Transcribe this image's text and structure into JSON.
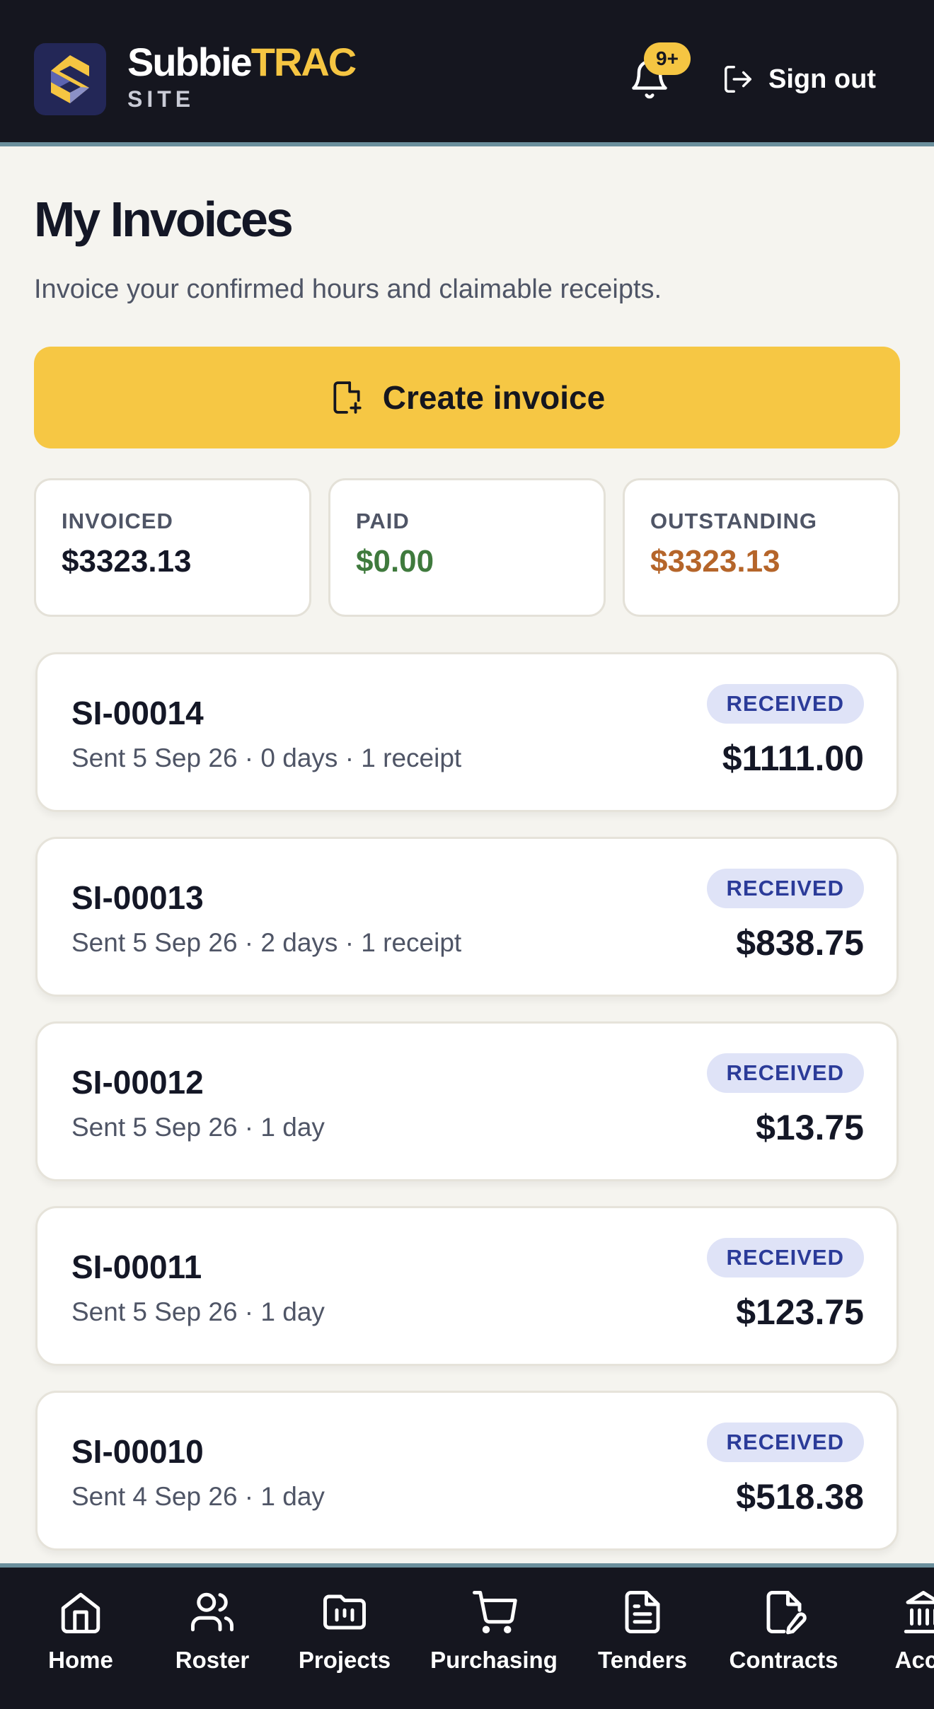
{
  "brand": {
    "name_a": "Subbie",
    "name_b": "TRAC",
    "sub": "SITE"
  },
  "header": {
    "badge": "9+",
    "signout_label": "Sign out"
  },
  "page": {
    "title": "My Invoices",
    "subtitle": "Invoice your confirmed hours and claimable receipts.",
    "create_label": "Create invoice"
  },
  "stats": [
    {
      "label": "INVOICED",
      "value": "$3323.13",
      "color": "#141726"
    },
    {
      "label": "PAID",
      "value": "$0.00",
      "color": "#3f7a3d"
    },
    {
      "label": "OUTSTANDING",
      "value": "$3323.13",
      "color": "#b5652a"
    }
  ],
  "invoices": [
    {
      "id": "SI-00014",
      "meta": "Sent 5 Sep 26 · 0 days · 1 receipt",
      "status": "RECEIVED",
      "amount": "$1111.00"
    },
    {
      "id": "SI-00013",
      "meta": "Sent 5 Sep 26 · 2 days · 1 receipt",
      "status": "RECEIVED",
      "amount": "$838.75"
    },
    {
      "id": "SI-00012",
      "meta": "Sent 5 Sep 26 · 1 day",
      "status": "RECEIVED",
      "amount": "$13.75"
    },
    {
      "id": "SI-00011",
      "meta": "Sent 5 Sep 26 · 1 day",
      "status": "RECEIVED",
      "amount": "$123.75"
    },
    {
      "id": "SI-00010",
      "meta": "Sent 4 Sep 26 · 1 day",
      "status": "RECEIVED",
      "amount": "$518.38"
    }
  ],
  "nav": [
    {
      "label": "Home",
      "icon": "home-icon"
    },
    {
      "label": "Roster",
      "icon": "users-icon"
    },
    {
      "label": "Projects",
      "icon": "folder-icon"
    },
    {
      "label": "Purchasing",
      "icon": "cart-icon"
    },
    {
      "label": "Tenders",
      "icon": "document-icon"
    },
    {
      "label": "Contracts",
      "icon": "contract-edit-icon"
    },
    {
      "label": "Acco",
      "icon": "bank-icon"
    }
  ]
}
